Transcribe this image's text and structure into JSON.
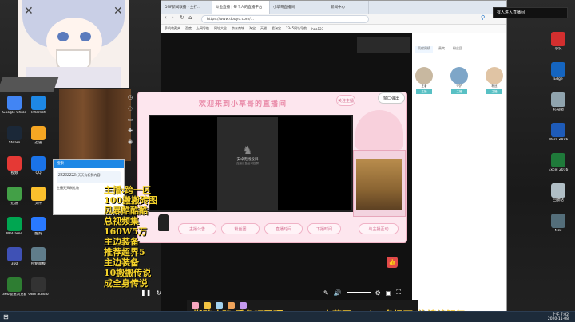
{
  "browser": {
    "tabs": [
      "DNF新闻联播 - 主打...",
      "斗鱼直播 | 每个人的直播平台",
      "小草哥直播间",
      "新闻中心"
    ],
    "url": "https://www.douyu.com/...",
    "bookmarks": [
      "手机收藏夹",
      "百度",
      "上网导航",
      "网址大全",
      "京东商城",
      "淘宝",
      "天猫",
      "爱淘宝",
      "2345网址导航",
      "hao123"
    ]
  },
  "stream": {
    "overlay_title": "欢迎来到小草哥的直播间",
    "overlay_top_right": "关注主播",
    "overlay_top_right2": "窗口弹出",
    "phone_label": "安卓无线投屏",
    "phone_sublabel": "连接设备后可投屏",
    "bottom_pills": [
      "主播公告",
      "粉丝团",
      "直播时间",
      "下播时间"
    ],
    "right_pill": "与主播互动",
    "left_yellow_lines": [
      "主播:跨一区",
      "100搬搬砖图",
      "风暴酷酷酷",
      "总视频集",
      "160W5万",
      "主边装备",
      "推荐超界5",
      "主边装备",
      "10搬搬传说",
      "成全身传说"
    ],
    "bottom_text": "搬砖攻略 看鱼吧置顶",
    "bottom_title": "小草哥 - Lisa名场面(热搜螃蟹舞)"
  },
  "right_panel": {
    "tabs": [
      "贡献周榜",
      "贵宾",
      "粉丝团"
    ],
    "users": [
      {
        "name": "王者",
        "badge": "主播"
      },
      {
        "name": "守护",
        "badge": "主播"
      },
      {
        "name": "粉丝",
        "badge": "主播"
      }
    ]
  },
  "chat": {
    "title": "搜索",
    "message": "ZZZZZZZZ: 天天有新鲜内容",
    "sender": "主播天天刷礼物"
  },
  "desktop": {
    "icons": [
      {
        "label": "Google Chrome",
        "color": "#4285f4"
      },
      {
        "label": "Internet",
        "color": "#1e88e5"
      },
      {
        "label": "Steam",
        "color": "#1b2838"
      },
      {
        "label": "迅雷",
        "color": "#f5a623"
      },
      {
        "label": "视频",
        "color": "#e53935"
      },
      {
        "label": "QQ",
        "color": "#1a73e8"
      },
      {
        "label": "迅游",
        "color": "#43a047"
      },
      {
        "label": "文件",
        "color": "#fbc02d"
      },
      {
        "label": "WeGame",
        "color": "#00a651"
      },
      {
        "label": "酷狗",
        "color": "#2979ff"
      },
      {
        "label": "360",
        "color": "#3f51b5"
      },
      {
        "label": "控制面板",
        "color": "#607d8b"
      },
      {
        "label": "360极速浏览器",
        "color": "#2e7d32"
      },
      {
        "label": "OBS Studio",
        "color": "#333333"
      }
    ],
    "right_icons": [
      {
        "label": "小说",
        "color": "#d32f2f"
      },
      {
        "label": "Edge",
        "color": "#1565c0"
      },
      {
        "label": "此电脑",
        "color": "#90a4ae"
      },
      {
        "label": "Word 2016",
        "color": "#1e5bb8"
      },
      {
        "label": "Excel 2016",
        "color": "#1f7a3a"
      },
      {
        "label": "回收站",
        "color": "#b0bec5"
      },
      {
        "label": "Mcc",
        "color": "#546e7a"
      }
    ]
  },
  "toast": "有人进入直播间",
  "taskbar": {
    "time": "上午 7:02",
    "date": "2020-11-08"
  }
}
